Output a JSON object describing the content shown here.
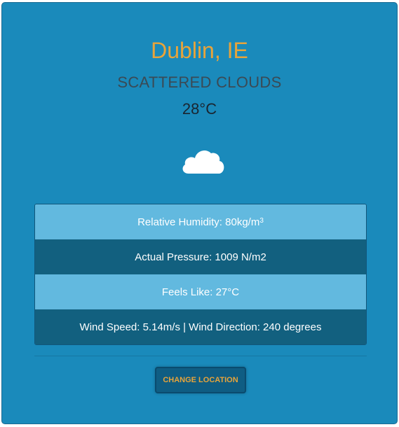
{
  "location": {
    "city": "Dublin, IE"
  },
  "weather": {
    "description": "SCATTERED CLOUDS",
    "temperature": "28°C",
    "icon": "cloud-icon"
  },
  "details": {
    "humidity_text": "Relative Humidity: 80kg/m",
    "humidity_sup": "3",
    "pressure": "Actual Pressure: 1009 N/m2",
    "feels_like": "Feels Like: 27°C",
    "wind": "Wind Speed: 5.14m/s | Wind Direction: 240 degrees"
  },
  "actions": {
    "change_location_label": "CHANGE LOCATION"
  },
  "colors": {
    "card_background": "#1a8abb",
    "accent": "#e8a43a",
    "row_light": "#62b9df",
    "row_dark": "#12607f"
  }
}
